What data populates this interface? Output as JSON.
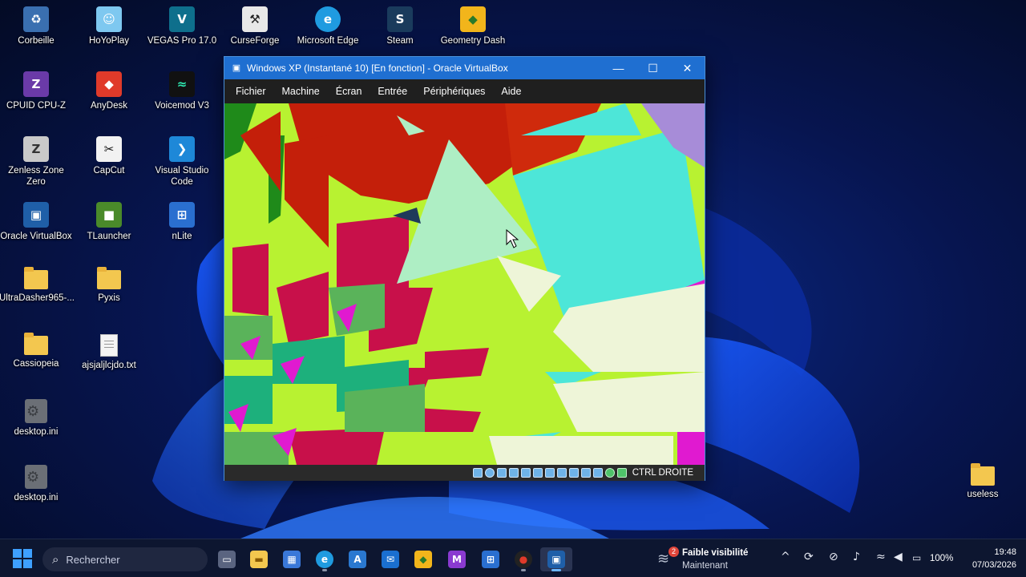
{
  "desktop": {
    "icons": [
      {
        "label": "Corbeille",
        "icon": "recycle-bin-icon",
        "color": "#3a6fb0",
        "glyph": "♻"
      },
      {
        "label": "HoYoPlay",
        "icon": "hoyoplay-icon",
        "color": "#7ec8f0",
        "glyph": "☺"
      },
      {
        "label": "VEGAS Pro 17.0",
        "icon": "vegas-pro-icon",
        "color": "#0e6f8c",
        "glyph": "V"
      },
      {
        "label": "CurseForge",
        "icon": "curseforge-icon",
        "color": "#e8e8e8",
        "glyph": "⚒"
      },
      {
        "label": "Microsoft Edge",
        "icon": "edge-icon",
        "color": "#1f9be0",
        "glyph": "e"
      },
      {
        "label": "Steam",
        "icon": "steam-icon",
        "color": "#1a3b5c",
        "glyph": "S"
      },
      {
        "label": "Geometry Dash",
        "icon": "geometry-dash-icon",
        "color": "#f2b51b",
        "glyph": "◆"
      },
      {
        "label": "CPUID CPU-Z",
        "icon": "cpuz-icon",
        "color": "#6a3aa8",
        "glyph": "Z"
      },
      {
        "label": "AnyDesk",
        "icon": "anydesk-icon",
        "color": "#e03a2a",
        "glyph": "◆"
      },
      {
        "label": "Voicemod V3",
        "icon": "voicemod-icon",
        "color": "#111111",
        "glyph": "≈"
      },
      {
        "label": "Zenless Zone Zero",
        "icon": "zenless-zone-zero-icon",
        "color": "#c9c9c9",
        "glyph": "Z"
      },
      {
        "label": "CapCut",
        "icon": "capcut-icon",
        "color": "#f2f2f2",
        "glyph": "✂"
      },
      {
        "label": "Visual Studio Code",
        "icon": "vscode-icon",
        "color": "#1e88d8",
        "glyph": "❯"
      },
      {
        "label": "Oracle VirtualBox",
        "icon": "virtualbox-icon",
        "color": "#1f5fa8",
        "glyph": "▣"
      },
      {
        "label": "TLauncher",
        "icon": "tlauncher-icon",
        "color": "#4a8a2a",
        "glyph": "■"
      },
      {
        "label": "nLite",
        "icon": "nlite-icon",
        "color": "#2a6fd0",
        "glyph": "⊞"
      },
      {
        "label": "UltraDasher965-...",
        "icon": "folder-icon",
        "color": "#f3c74f",
        "glyph": ""
      },
      {
        "label": "Pyxis",
        "icon": "folder-icon",
        "color": "#f3c74f",
        "glyph": ""
      },
      {
        "label": "Cassiopeia",
        "icon": "folder-icon",
        "color": "#f3c74f",
        "glyph": ""
      },
      {
        "label": "ajsjaljlcjdo.txt",
        "icon": "text-file-icon",
        "color": "#f4f4f4",
        "glyph": ""
      },
      {
        "label": "desktop.ini",
        "icon": "settings-file-icon",
        "color": "#6b6f76",
        "glyph": ""
      },
      {
        "label": "desktop.ini",
        "icon": "settings-file-icon",
        "color": "#6b6f76",
        "glyph": ""
      },
      {
        "label": "useless",
        "icon": "folder-icon",
        "color": "#f3c74f",
        "glyph": ""
      }
    ]
  },
  "vbox": {
    "title": "Windows XP (Instantané 10) [En fonction] - Oracle VirtualBox",
    "controls": {
      "minimize": "—",
      "maximize": "☐",
      "close": "✕"
    },
    "menu": [
      "Fichier",
      "Machine",
      "Écran",
      "Entrée",
      "Périphériques",
      "Aide"
    ],
    "status_icons": [
      "hard-disk-icon",
      "optical-drive-icon",
      "floppy-icon",
      "audio-icon",
      "network-icon",
      "usb-icon",
      "shared-folder-icon",
      "display-icon",
      "video-capture-icon",
      "record-icon",
      "cpu-icon",
      "mouse-integration-icon",
      "keyboard-icon"
    ],
    "host_key": "CTRL DROITE",
    "accent": "#1f6fd1"
  },
  "taskbar": {
    "search_placeholder": "Rechercher",
    "weather_badge": "2",
    "weather_line1": "Faible visibilité",
    "weather_line2": "Maintenant",
    "tray_chevron": "^",
    "battery": "100%",
    "time": "19:48",
    "date": "07/03/2026",
    "apps": [
      {
        "icon": "task-view-icon",
        "color": "#5a6480",
        "glyph": "▭"
      },
      {
        "icon": "file-explorer-icon",
        "color": "#f3c74f",
        "glyph": "▬"
      },
      {
        "icon": "microsoft-store-icon",
        "color": "#3a78d8",
        "glyph": "▦"
      },
      {
        "icon": "edge-icon",
        "color": "#1f9be0",
        "glyph": "e"
      },
      {
        "icon": "visual-studio-icon",
        "color": "#2a78d0",
        "glyph": "A"
      },
      {
        "icon": "outlook-icon",
        "color": "#1a6fd0",
        "glyph": "✉"
      },
      {
        "icon": "geometry-dash-icon",
        "color": "#f2b51b",
        "glyph": "◆"
      },
      {
        "icon": "visual-studio-purple-icon",
        "color": "#8a3ad0",
        "glyph": "M"
      },
      {
        "icon": "nlite-icon",
        "color": "#2a6fd0",
        "glyph": "⊞"
      },
      {
        "icon": "obs-icon",
        "color": "#222222",
        "glyph": "●"
      },
      {
        "icon": "virtualbox-icon",
        "color": "#1f5fa8",
        "glyph": "▣"
      }
    ]
  }
}
